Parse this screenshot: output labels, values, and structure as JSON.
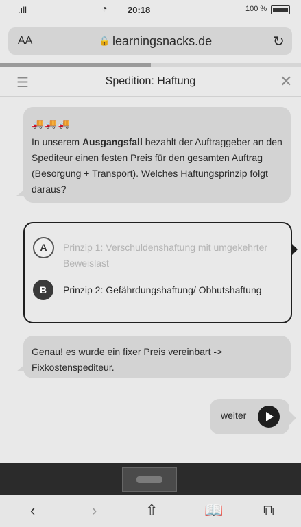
{
  "status_bar": {
    "signal_label": ".ıll",
    "wifi_icon": "wifi-icon",
    "time": "20:18",
    "battery_label": "100 %"
  },
  "url_bar": {
    "text_size_label": "AA",
    "lock_icon": "lock-icon",
    "domain": "learningsnacks.de",
    "reload_icon": "reload-icon"
  },
  "lesson_progress": 0.5,
  "topic_bar": {
    "menu_icon": "hamburger-menu-icon",
    "title": "Spedition: Haftung",
    "close_icon": "close-icon"
  },
  "question": {
    "trucks": "🚚🚚🚚",
    "text_before": "In unserem ",
    "text_bold": "Ausgangsfall",
    "text_after": " bezahlt der Auftraggeber an den Spediteur einen festen Preis für den gesamten Auftrag (Besorgung + Transport). Welches Haftungsprinzip folgt daraus?"
  },
  "choices": [
    {
      "letter": "A",
      "label": "Prinzip 1: Verschuldenshaftung mit umgekehrter Beweislast"
    },
    {
      "letter": "B",
      "label": "Prinzip 2: Gefährdungshaftung/ Obhutshaftung"
    }
  ],
  "feedback": {
    "text": "Genau! es wurde ein fixer Preis vereinbart -> Fixkostenspediteur."
  },
  "continue_button": {
    "label": "weiter",
    "icon": "play-icon"
  },
  "bottom_toolbar": {
    "back": "‹",
    "forward": "›",
    "share": "⇧",
    "bookmarks": "📖",
    "tabs": "⧉"
  },
  "colors": {
    "bubble": "#d3d3d3",
    "dark": "#1f1f1f",
    "background": "#e9e9e9"
  }
}
